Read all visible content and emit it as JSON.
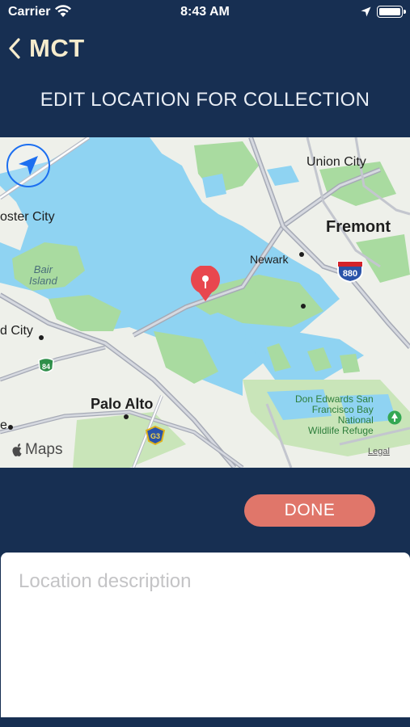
{
  "status_bar": {
    "carrier": "Carrier",
    "time": "8:43 AM",
    "icons": [
      "wifi-icon",
      "location-arrow-icon",
      "battery-icon"
    ],
    "battery_level": 1.0
  },
  "nav": {
    "back_icon": "chevron-left-icon",
    "title": "MCT"
  },
  "page": {
    "heading": "EDIT LOCATION FOR COLLECTION"
  },
  "map": {
    "labels": {
      "union_city": "Union City",
      "foster_city": "oster City",
      "fremont": "Fremont",
      "newark": "Newark",
      "bair_island_1": "Bair",
      "bair_island_2": "Island",
      "redwood_city": "d City",
      "palo_alto": "Palo Alto",
      "mountain_view": "e",
      "refuge_1": "Don Edwards San",
      "refuge_2": "Francisco Bay",
      "refuge_3": "National",
      "refuge_4": "Wildlife Refuge"
    },
    "shields": {
      "i880": "880",
      "ca84": "84",
      "g3": "G3"
    },
    "brand": "Maps",
    "legal": "Legal",
    "icons": [
      "locate-arrow-icon",
      "map-pin-icon",
      "apple-logo-icon",
      "park-icon"
    ]
  },
  "actions": {
    "done_label": "DONE"
  },
  "description": {
    "placeholder": "Location description",
    "value": ""
  },
  "colors": {
    "background": "#172f52",
    "title": "#f6eccd",
    "done_button": "#e0766a",
    "water": "#8fd3f2",
    "land": "#eef0ea",
    "park": "#a9dba0",
    "pin": "#e8474e",
    "locate": "#1c6ff0"
  }
}
